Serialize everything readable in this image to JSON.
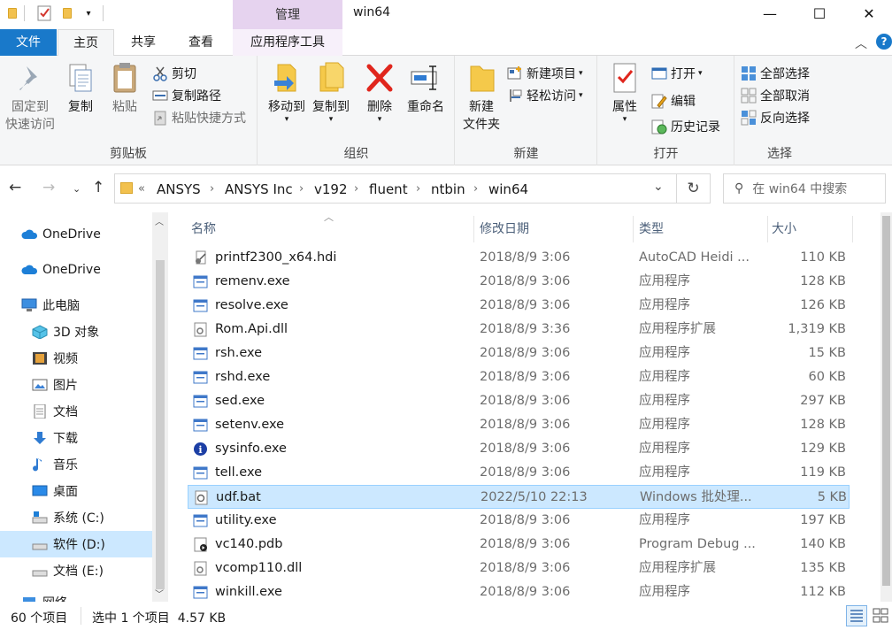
{
  "window": {
    "title": "win64",
    "context_tab": "管理",
    "controls": {
      "minimize": "—",
      "maximize": "☐",
      "close": "✕"
    }
  },
  "ribbon_tabs": [
    "文件",
    "主页",
    "共享",
    "查看",
    "应用程序工具"
  ],
  "ribbon": {
    "clipboard": {
      "label": "剪贴板",
      "pin": "固定到\n快速访问",
      "pin_l1": "固定到",
      "pin_l2": "快速访问",
      "copy": "复制",
      "paste": "粘贴",
      "cut": "剪切",
      "copy_path": "复制路径",
      "paste_shortcut": "粘贴快捷方式"
    },
    "organize": {
      "label": "组织",
      "move_to": "移动到",
      "copy_to": "复制到",
      "delete": "删除",
      "rename": "重命名"
    },
    "new": {
      "label": "新建",
      "new_folder_l1": "新建",
      "new_folder_l2": "文件夹",
      "new_item": "新建项目",
      "easy_access": "轻松访问"
    },
    "open": {
      "label": "打开",
      "properties": "属性",
      "open": "打开",
      "edit": "编辑",
      "history": "历史记录"
    },
    "select": {
      "label": "选择",
      "select_all": "全部选择",
      "select_none": "全部取消",
      "invert": "反向选择"
    }
  },
  "address": {
    "overflow": "«",
    "crumbs": [
      "ANSYS",
      "ANSYS Inc",
      "v192",
      "fluent",
      "ntbin",
      "win64"
    ],
    "search_placeholder": "在 win64 中搜索"
  },
  "nav": [
    {
      "label": "OneDrive",
      "icon": "cloud-icon"
    },
    {
      "label": "OneDrive",
      "icon": "cloud-icon"
    },
    {
      "label": "此电脑",
      "icon": "computer-icon"
    },
    {
      "label": "3D 对象",
      "icon": "cube-icon"
    },
    {
      "label": "视频",
      "icon": "film-icon"
    },
    {
      "label": "图片",
      "icon": "picture-icon"
    },
    {
      "label": "文档",
      "icon": "document-icon"
    },
    {
      "label": "下载",
      "icon": "download-icon"
    },
    {
      "label": "音乐",
      "icon": "music-icon"
    },
    {
      "label": "桌面",
      "icon": "desktop-icon"
    },
    {
      "label": "系统 (C:)",
      "icon": "drive-icon"
    },
    {
      "label": "软件 (D:)",
      "icon": "drive-icon"
    },
    {
      "label": "文档 (E:)",
      "icon": "drive-icon"
    },
    {
      "label": "网络",
      "icon": "network-icon"
    }
  ],
  "columns": {
    "name": "名称",
    "date": "修改日期",
    "type": "类型",
    "size": "大小"
  },
  "files": [
    {
      "name": "printf2300_x64.hdi",
      "date": "2018/8/9 3:06",
      "type": "AutoCAD Heidi ...",
      "size": "110 KB",
      "icon": "hdi-icon"
    },
    {
      "name": "remenv.exe",
      "date": "2018/8/9 3:06",
      "type": "应用程序",
      "size": "128 KB",
      "icon": "exe-icon"
    },
    {
      "name": "resolve.exe",
      "date": "2018/8/9 3:06",
      "type": "应用程序",
      "size": "126 KB",
      "icon": "exe-icon"
    },
    {
      "name": "Rom.Api.dll",
      "date": "2018/8/9 3:36",
      "type": "应用程序扩展",
      "size": "1,319 KB",
      "icon": "dll-icon"
    },
    {
      "name": "rsh.exe",
      "date": "2018/8/9 3:06",
      "type": "应用程序",
      "size": "15 KB",
      "icon": "exe-icon"
    },
    {
      "name": "rshd.exe",
      "date": "2018/8/9 3:06",
      "type": "应用程序",
      "size": "60 KB",
      "icon": "exe-icon"
    },
    {
      "name": "sed.exe",
      "date": "2018/8/9 3:06",
      "type": "应用程序",
      "size": "297 KB",
      "icon": "exe-icon"
    },
    {
      "name": "setenv.exe",
      "date": "2018/8/9 3:06",
      "type": "应用程序",
      "size": "128 KB",
      "icon": "exe-icon"
    },
    {
      "name": "sysinfo.exe",
      "date": "2018/8/9 3:06",
      "type": "应用程序",
      "size": "129 KB",
      "icon": "info-icon"
    },
    {
      "name": "tell.exe",
      "date": "2018/8/9 3:06",
      "type": "应用程序",
      "size": "119 KB",
      "icon": "exe-icon"
    },
    {
      "name": "udf.bat",
      "date": "2022/5/10 22:13",
      "type": "Windows 批处理...",
      "size": "5 KB",
      "icon": "bat-icon",
      "selected": true
    },
    {
      "name": "utility.exe",
      "date": "2018/8/9 3:06",
      "type": "应用程序",
      "size": "197 KB",
      "icon": "exe-icon"
    },
    {
      "name": "vc140.pdb",
      "date": "2018/8/9 3:06",
      "type": "Program Debug ...",
      "size": "140 KB",
      "icon": "pdb-icon"
    },
    {
      "name": "vcomp110.dll",
      "date": "2018/8/9 3:06",
      "type": "应用程序扩展",
      "size": "135 KB",
      "icon": "dll-icon"
    },
    {
      "name": "winkill.exe",
      "date": "2018/8/9 3:06",
      "type": "应用程序",
      "size": "112 KB",
      "icon": "exe-icon"
    }
  ],
  "status": {
    "item_count": "60 个项目",
    "selection": "选中 1 个项目  4.57 KB"
  },
  "colors": {
    "accent": "#1979ca",
    "selection_bg": "#cce8ff",
    "selection_border": "#99d1ff",
    "context_tab": "#e6d3ef"
  }
}
